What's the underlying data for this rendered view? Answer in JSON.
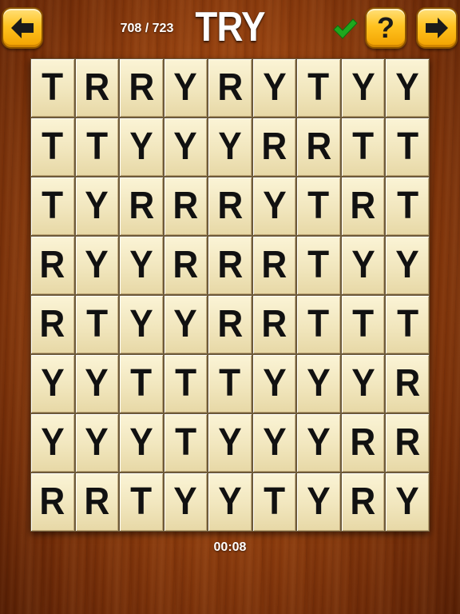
{
  "header": {
    "progress": "708 / 723",
    "target_word": "TRY",
    "word_found_status": "check-icon"
  },
  "buttons": {
    "back": {
      "icon": "arrow-left-icon"
    },
    "help": {
      "icon": "question-mark-icon",
      "label": "?"
    },
    "next": {
      "icon": "arrow-right-icon"
    }
  },
  "colors": {
    "button_gold": "#ffc21f",
    "check_green": "#1ea81e",
    "tile": "#f1e6bd",
    "wood": "#97420f"
  },
  "grid": {
    "rows": [
      [
        "T",
        "R",
        "R",
        "Y",
        "R",
        "Y",
        "T",
        "Y",
        "Y"
      ],
      [
        "T",
        "T",
        "Y",
        "Y",
        "Y",
        "R",
        "R",
        "T",
        "T"
      ],
      [
        "T",
        "Y",
        "R",
        "R",
        "R",
        "Y",
        "T",
        "R",
        "T"
      ],
      [
        "R",
        "Y",
        "Y",
        "R",
        "R",
        "R",
        "T",
        "Y",
        "Y"
      ],
      [
        "R",
        "T",
        "Y",
        "Y",
        "R",
        "R",
        "T",
        "T",
        "T"
      ],
      [
        "Y",
        "Y",
        "T",
        "T",
        "T",
        "Y",
        "Y",
        "Y",
        "R"
      ],
      [
        "Y",
        "Y",
        "Y",
        "T",
        "Y",
        "Y",
        "Y",
        "R",
        "R"
      ],
      [
        "R",
        "R",
        "T",
        "Y",
        "Y",
        "T",
        "Y",
        "R",
        "Y"
      ]
    ]
  },
  "footer": {
    "timer": "00:08"
  }
}
